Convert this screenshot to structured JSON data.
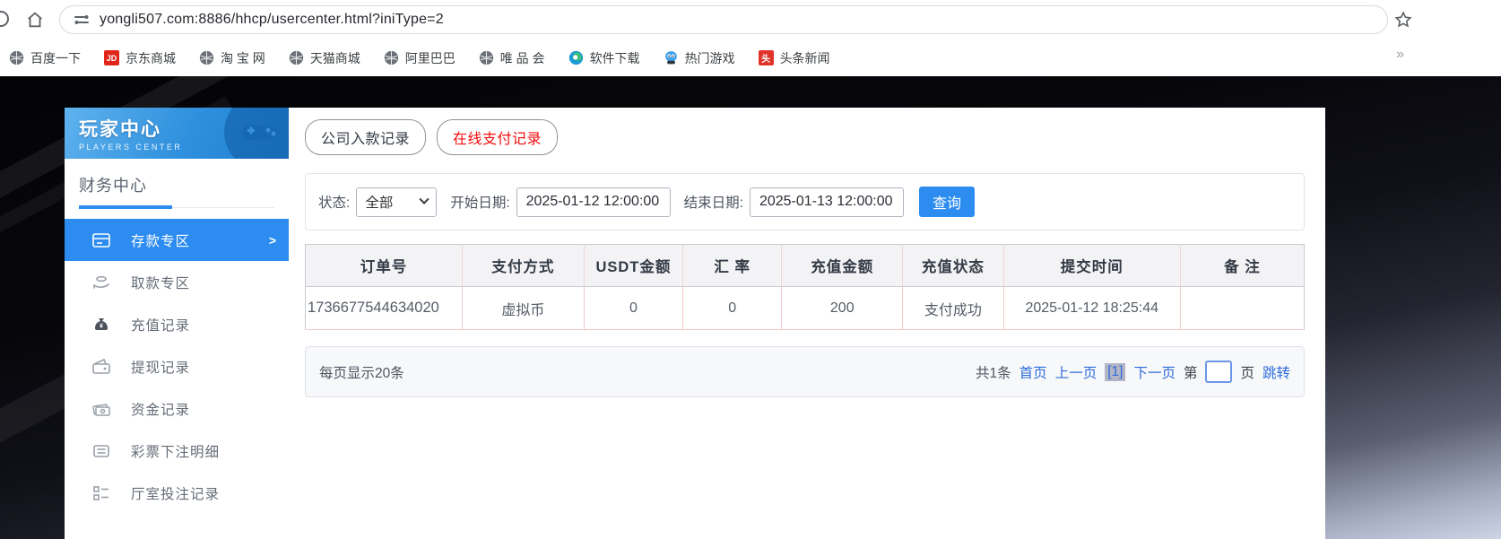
{
  "browser": {
    "url": "yongli507.com:8886/hhcp/usercenter.html?iniType=2",
    "bookmarks": [
      {
        "label": "百度一下",
        "icon": "globe"
      },
      {
        "label": "京东商城",
        "icon": "jd",
        "badge": "JD"
      },
      {
        "label": "淘 宝 网",
        "icon": "globe"
      },
      {
        "label": "天猫商城",
        "icon": "globe"
      },
      {
        "label": "阿里巴巴",
        "icon": "globe"
      },
      {
        "label": "唯 品 会",
        "icon": "globe"
      },
      {
        "label": "软件下载",
        "icon": "software"
      },
      {
        "label": "热门游戏",
        "icon": "game"
      },
      {
        "label": "头条新闻",
        "icon": "toutiao",
        "badge": "头"
      }
    ],
    "overflow_chevron": "»"
  },
  "sidebar": {
    "title": "玩家中心",
    "subtitle": "PLAYERS CENTER",
    "section_title": "财务中心",
    "items": [
      {
        "label": "存款专区",
        "active": true,
        "chevron": ">"
      },
      {
        "label": "取款专区"
      },
      {
        "label": "充值记录"
      },
      {
        "label": "提现记录"
      },
      {
        "label": "资金记录"
      },
      {
        "label": "彩票下注明细"
      },
      {
        "label": "厅室投注记录"
      }
    ]
  },
  "tabs": [
    {
      "label": "公司入款记录",
      "active": false
    },
    {
      "label": "在线支付记录",
      "active": true
    }
  ],
  "filters": {
    "status_label": "状态:",
    "status_value": "全部",
    "start_label": "开始日期:",
    "start_value": "2025-01-12 12:00:00",
    "end_label": "结束日期:",
    "end_value": "2025-01-13 12:00:00",
    "query_label": "查询"
  },
  "table": {
    "headers": [
      "订单号",
      "支付方式",
      "USDT金额",
      "汇 率",
      "充值金额",
      "充值状态",
      "提交时间",
      "备 注"
    ],
    "rows": [
      [
        "1736677544634020",
        "虚拟币",
        "0",
        "0",
        "200",
        "支付成功",
        "2025-01-12 18:25:44",
        ""
      ]
    ]
  },
  "pagination": {
    "per_page": "每页显示20条",
    "total": "共1条",
    "first": "首页",
    "prev": "上一页",
    "current": "[1]",
    "next": "下一页",
    "jump_pre": "第",
    "jump_post": "页",
    "jump": "跳转",
    "page_input_value": ""
  },
  "colors": {
    "accent_blue": "#2d8cf0",
    "active_tab_red": "#f20d0d",
    "link_blue": "#2e6cd9",
    "table_border_pink": "#f2c9c9",
    "jd_red": "#e1251b",
    "toutiao_red": "#e0342b"
  }
}
